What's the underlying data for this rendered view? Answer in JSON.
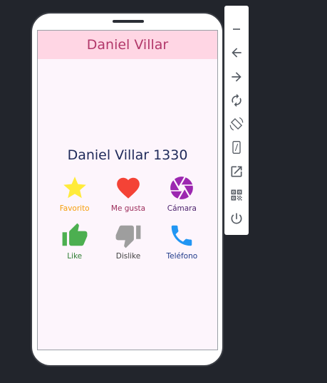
{
  "app": {
    "appbar_title": "Daniel Villar",
    "heading": "Daniel Villar 1330"
  },
  "buttons": [
    {
      "label": "Favorito",
      "icon": "star-icon",
      "color": "#ffeb3b",
      "label_color": "#f59e0b"
    },
    {
      "label": "Me gusta",
      "icon": "heart-icon",
      "color": "#f44336",
      "label_color": "#9c2c5a"
    },
    {
      "label": "Cámara",
      "icon": "camera-shutter-icon",
      "color": "#9c27b0",
      "label_color": "#4a1f6b"
    },
    {
      "label": "Like",
      "icon": "thumb-up-icon",
      "color": "#4caf50",
      "label_color": "#2e7d32"
    },
    {
      "label": "Dislike",
      "icon": "thumb-down-icon",
      "color": "#9e9e9e",
      "label_color": "#424242"
    },
    {
      "label": "Teléfono",
      "icon": "phone-icon",
      "color": "#2196f3",
      "label_color": "#1f3a8a"
    }
  ],
  "emulator_toolbar": [
    {
      "name": "minimize",
      "icon": "minimize-icon"
    },
    {
      "name": "back",
      "icon": "arrow-left-icon"
    },
    {
      "name": "forward",
      "icon": "arrow-right-icon"
    },
    {
      "name": "rotate",
      "icon": "rotate-icon"
    },
    {
      "name": "rotate-device",
      "icon": "screen-rotation-icon"
    },
    {
      "name": "device-frame",
      "icon": "phone-frame-icon"
    },
    {
      "name": "open-external",
      "icon": "open-in-new-icon"
    },
    {
      "name": "qr-code",
      "icon": "qr-code-icon"
    },
    {
      "name": "power",
      "icon": "power-icon"
    }
  ]
}
